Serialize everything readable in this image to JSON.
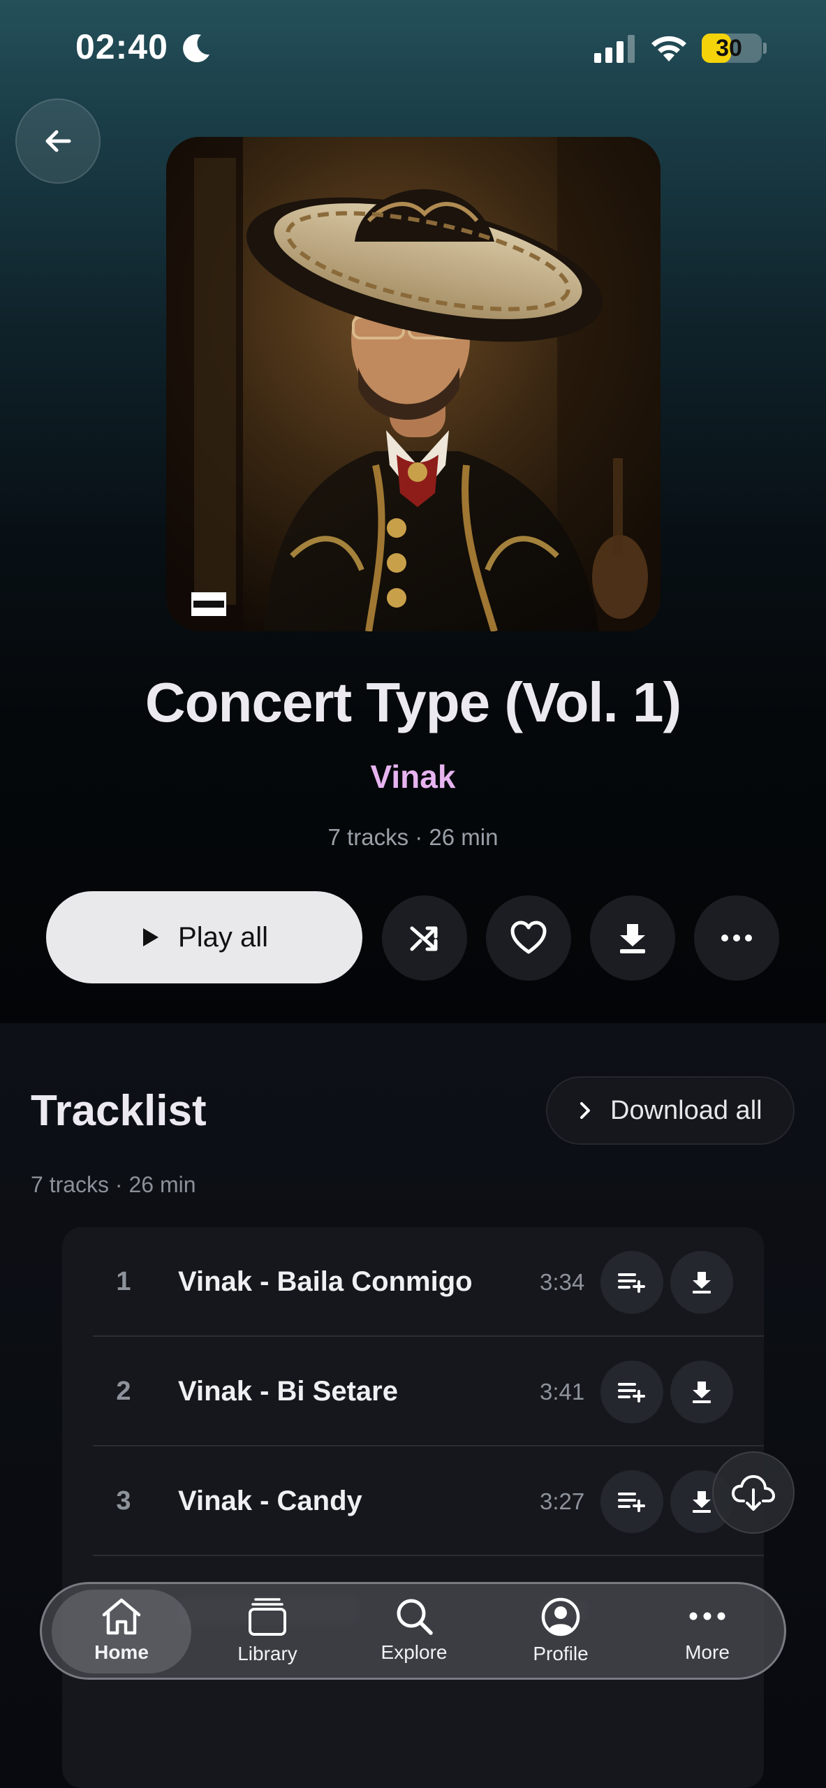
{
  "status_bar": {
    "time": "02:40",
    "battery": "30",
    "battery_level_percent": 30,
    "battery_color": "#f5d30a"
  },
  "album": {
    "title": "Concert Type (Vol. 1)",
    "artist": "Vinak",
    "meta": "7 tracks · 26 min",
    "artist_color": "#e7b4f0"
  },
  "actions": {
    "play_all": "Play all",
    "icons": [
      "shuffle-icon",
      "heart-icon",
      "download-icon",
      "more-icon"
    ]
  },
  "tracklist": {
    "title": "Tracklist",
    "download_all": "Download all",
    "meta": "7 tracks · 26 min",
    "tracks": [
      {
        "number": "1",
        "name": "Vinak - Baila Conmigo",
        "duration": "3:34"
      },
      {
        "number": "2",
        "name": "Vinak - Bi Setare",
        "duration": "3:41"
      },
      {
        "number": "3",
        "name": "Vinak - Candy",
        "duration": "3:27"
      }
    ]
  },
  "nav": {
    "items": [
      {
        "label": "Home",
        "icon": "home-icon",
        "active": true
      },
      {
        "label": "Library",
        "icon": "library-icon",
        "active": false
      },
      {
        "label": "Explore",
        "icon": "search-icon",
        "active": false
      },
      {
        "label": "Profile",
        "icon": "profile-icon",
        "active": false
      },
      {
        "label": "More",
        "icon": "more-icon",
        "active": false
      }
    ]
  }
}
